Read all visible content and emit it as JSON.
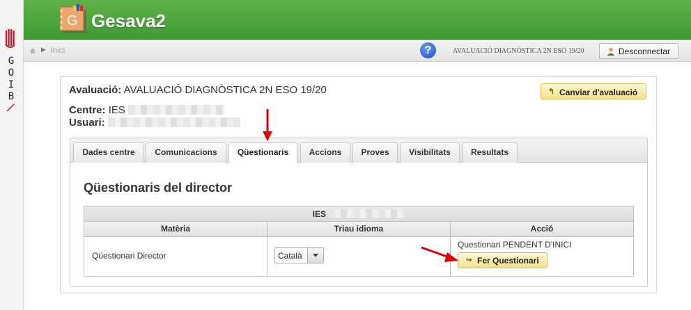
{
  "brand": {
    "side_letters": [
      "G",
      "O",
      "I",
      "B"
    ],
    "app_icon_letter": "G",
    "app_title": "Gesava2"
  },
  "toolbar": {
    "breadcrumb": "Inici",
    "help_symbol": "?",
    "evaluation_name": "AVALUACIÓ DIAGNÒSTICA 2N ESO 19/20",
    "logout_label": "Desconnectar"
  },
  "info": {
    "eval_label": "Avaluació:",
    "eval_value": "AVALUACIÓ DIAGNÒSTICA 2N ESO 19/20",
    "centre_label": "Centre:",
    "centre_value": "IES",
    "usuari_label": "Usuari:",
    "change_button": "Canviar d'avaluació"
  },
  "tabs": [
    {
      "label": "Dades centre"
    },
    {
      "label": "Comunicacions"
    },
    {
      "label": "Qüestionaris"
    },
    {
      "label": "Accions"
    },
    {
      "label": "Proves"
    },
    {
      "label": "Visibilitats"
    },
    {
      "label": "Resultats"
    }
  ],
  "active_tab": "Qüestionaris",
  "section_title": "Qüestionaris del director",
  "table": {
    "caption": "IES",
    "headers": [
      "Matèria",
      "Triau idioma",
      "Acció"
    ],
    "row": {
      "subject": "Qüestionari Director",
      "language": "Català",
      "status": "Questionari PENDENT D'INICI",
      "action_button": "Fer Questionari"
    }
  },
  "colors": {
    "header_green": "#4aa43b",
    "button_yellow": "#f5e08a",
    "annotation_red": "#e00000"
  }
}
